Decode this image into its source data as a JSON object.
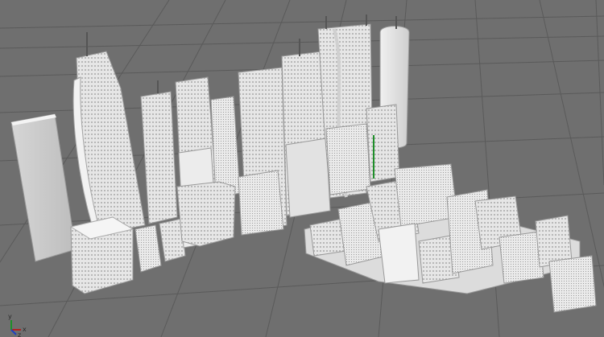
{
  "viewport": {
    "background": "#6f6f6f",
    "grid_color": "#555555",
    "model_color": "#e6e6e6",
    "model_shade": "#bdbdbd",
    "axis_gizmo": {
      "x_label": "x",
      "y_label": "y",
      "z_label": "z",
      "x_color": "#b32020",
      "y_color": "#1f8f2a",
      "z_color": "#2040c0"
    }
  }
}
